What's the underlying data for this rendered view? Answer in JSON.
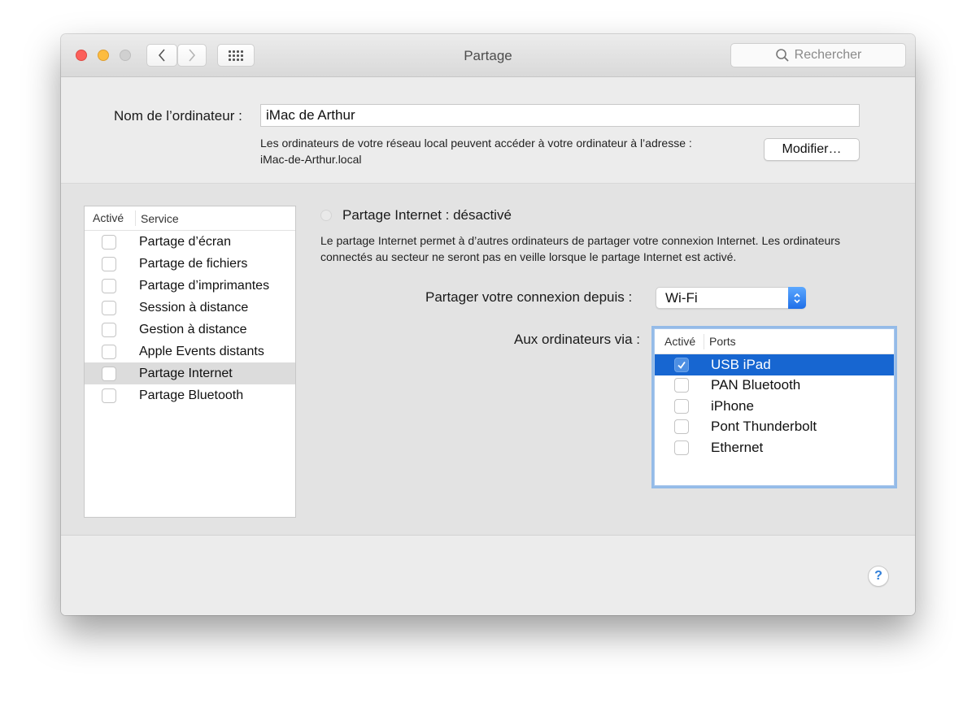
{
  "window": {
    "title": "Partage",
    "search_placeholder": "Rechercher",
    "icons": {
      "close": "red-close-icon",
      "minimize": "yellow-minimize-icon",
      "zoom": "gray-zoom-icon",
      "back": "chevron-left-icon",
      "forward": "chevron-right-icon",
      "show_all": "grid-icon",
      "search": "magnifier-icon"
    }
  },
  "computer_name": {
    "label": "Nom de l’ordinateur :",
    "value": "iMac de Arthur",
    "address_text": "Les ordinateurs de votre réseau local peuvent accéder à votre ordinateur à l’adresse :",
    "address": "iMac-de-Arthur.local",
    "modify_button": "Modifier…"
  },
  "services": {
    "columns": [
      "Activé",
      "Service"
    ],
    "items": [
      {
        "label": "Partage d’écran",
        "enabled": false,
        "selected": false
      },
      {
        "label": "Partage de fichiers",
        "enabled": false,
        "selected": false
      },
      {
        "label": "Partage d’imprimantes",
        "enabled": false,
        "selected": false
      },
      {
        "label": "Session à distance",
        "enabled": false,
        "selected": false
      },
      {
        "label": "Gestion à distance",
        "enabled": false,
        "selected": false
      },
      {
        "label": "Apple Events distants",
        "enabled": false,
        "selected": false
      },
      {
        "label": "Partage Internet",
        "enabled": false,
        "selected": true
      },
      {
        "label": "Partage Bluetooth",
        "enabled": false,
        "selected": false
      }
    ]
  },
  "detail": {
    "status_title": "Partage Internet : désactivé",
    "description": "Le partage Internet permet à d’autres ordinateurs de partager votre connexion Internet. Les ordinateurs connectés au secteur ne seront pas en veille lorsque le partage Internet est activé.",
    "share_from_label": "Partager votre connexion depuis :",
    "share_from_value": "Wi-Fi",
    "via_label": "Aux ordinateurs via :",
    "ports_columns": [
      "Activé",
      "Ports"
    ],
    "ports": [
      {
        "label": "USB iPad",
        "enabled": true,
        "selected": true
      },
      {
        "label": "PAN Bluetooth",
        "enabled": false,
        "selected": false
      },
      {
        "label": "iPhone",
        "enabled": false,
        "selected": false
      },
      {
        "label": "Pont Thunderbolt",
        "enabled": false,
        "selected": false
      },
      {
        "label": "Ethernet",
        "enabled": false,
        "selected": false
      }
    ]
  },
  "help_button": "?",
  "colors": {
    "selection_blue": "#1766d1",
    "focus_ring": "#94bbe8",
    "help_blue": "#2f7ed8"
  }
}
